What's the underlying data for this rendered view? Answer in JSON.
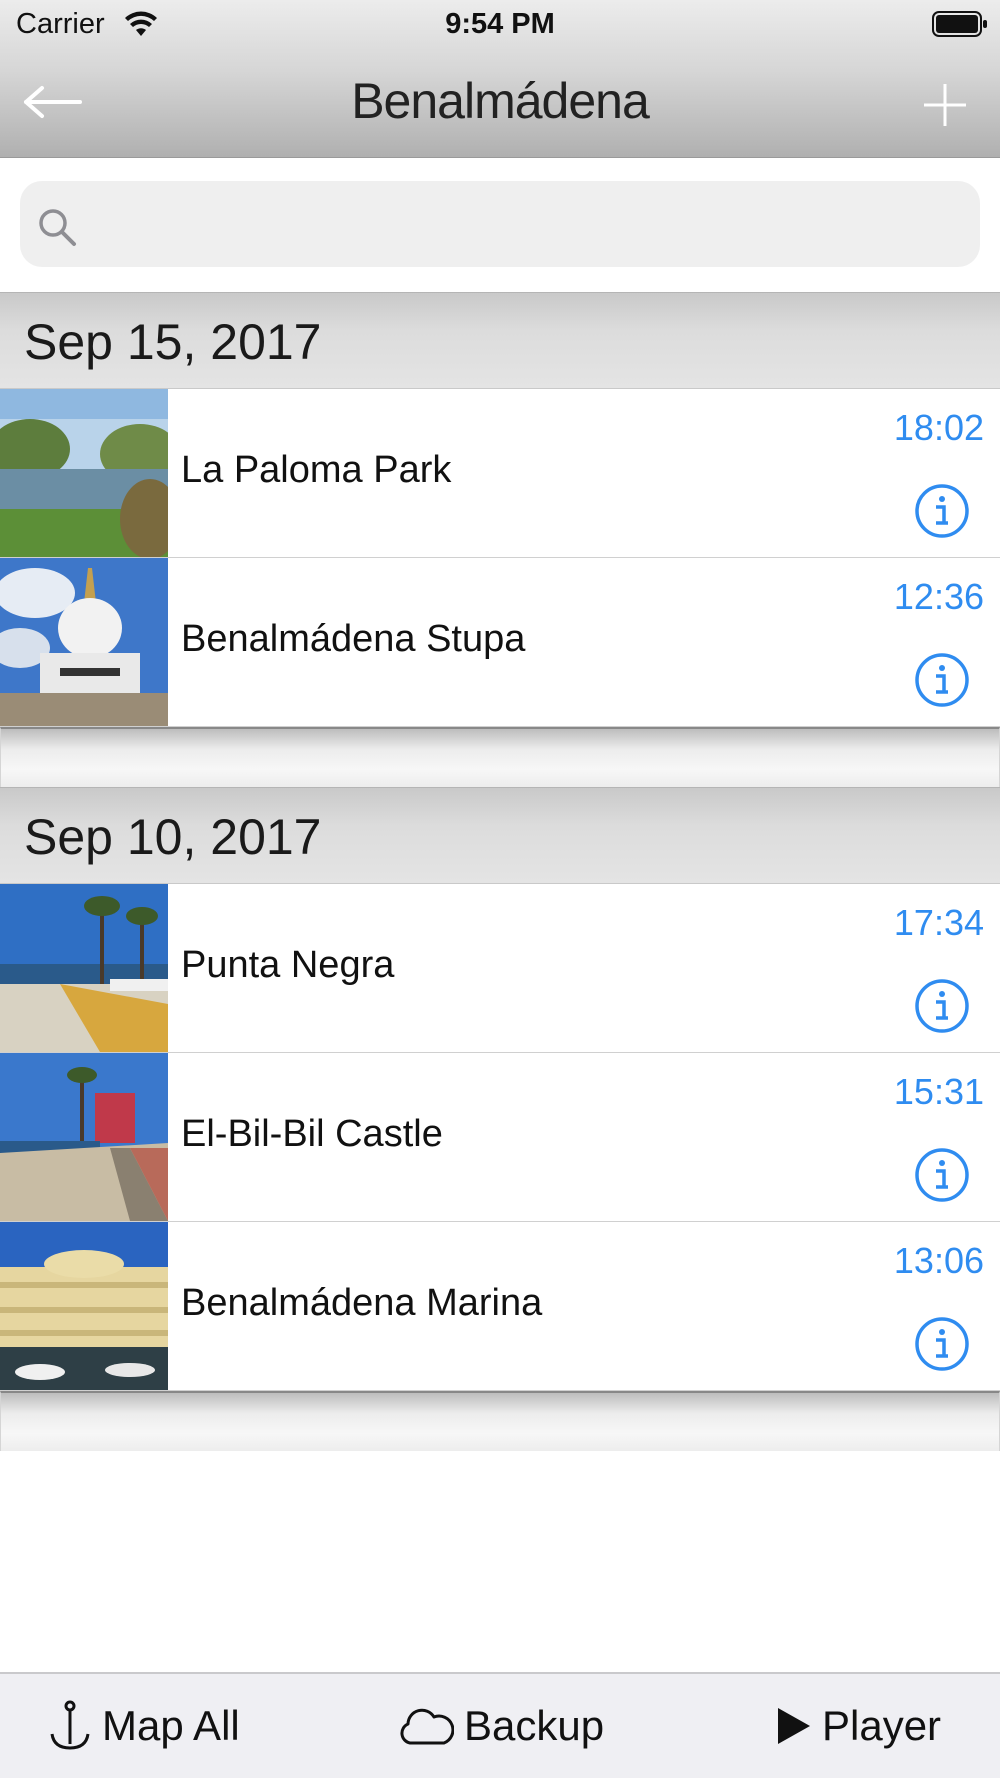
{
  "status_bar": {
    "carrier": "Carrier",
    "time": "9:54 PM"
  },
  "nav": {
    "title": "Benalmádena",
    "back_icon": "arrow-left-icon",
    "add_icon": "plus-icon"
  },
  "search": {
    "placeholder": "",
    "value": ""
  },
  "sections": [
    {
      "header": "Sep 15, 2017",
      "items": [
        {
          "title": "La Paloma Park",
          "time": "18:02"
        },
        {
          "title": "Benalmádena Stupa",
          "time": "12:36"
        }
      ]
    },
    {
      "header": "Sep 10, 2017",
      "items": [
        {
          "title": "Punta Negra",
          "time": "17:34"
        },
        {
          "title": "El-Bil-Bil Castle",
          "time": "15:31"
        },
        {
          "title": "Benalmádena Marina",
          "time": "13:06"
        }
      ]
    }
  ],
  "toolbar": {
    "map_all": "Map All",
    "backup": "Backup",
    "player": "Player"
  },
  "colors": {
    "accent": "#2f8cf0",
    "nav_gradient_top": "#ececec",
    "nav_gradient_bottom": "#b0b0b0"
  }
}
